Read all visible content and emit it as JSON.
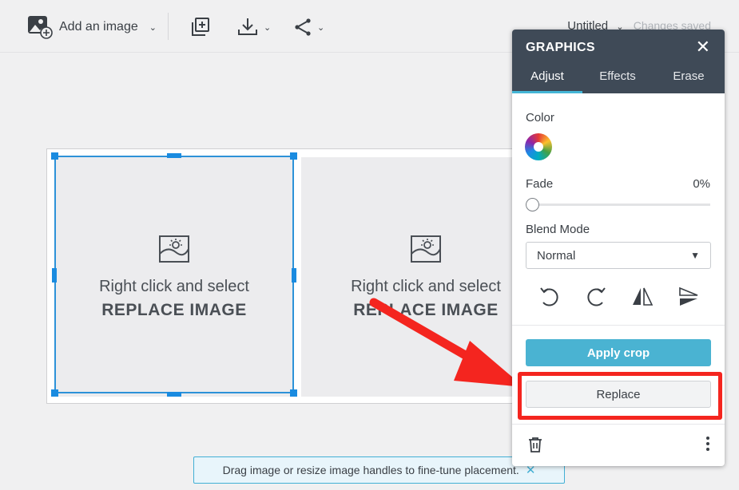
{
  "toolbar": {
    "add_image_label": "Add an image",
    "doc_title": "Untitled",
    "save_status": "Changes saved"
  },
  "canvas": {
    "slots": [
      {
        "line1": "Right click and select",
        "line2": "REPLACE IMAGE"
      },
      {
        "line1": "Right click and select",
        "line2": "REPLACE IMAGE"
      }
    ]
  },
  "tip": {
    "text": "Drag image or resize image handles to fine-tune placement.",
    "close_glyph": "✕"
  },
  "panel": {
    "title": "GRAPHICS",
    "close_glyph": "✕",
    "tabs": {
      "adjust": "Adjust",
      "effects": "Effects",
      "erase": "Erase"
    },
    "color_label": "Color",
    "fade_label": "Fade",
    "fade_value": "0%",
    "blend_label": "Blend Mode",
    "blend_value": "Normal",
    "apply_crop_label": "Apply crop",
    "replace_label": "Replace"
  },
  "colors": {
    "panel_header": "#3f4a57",
    "accent": "#4ab3d2",
    "selection": "#2d92d8",
    "annotation": "#f4251f"
  }
}
